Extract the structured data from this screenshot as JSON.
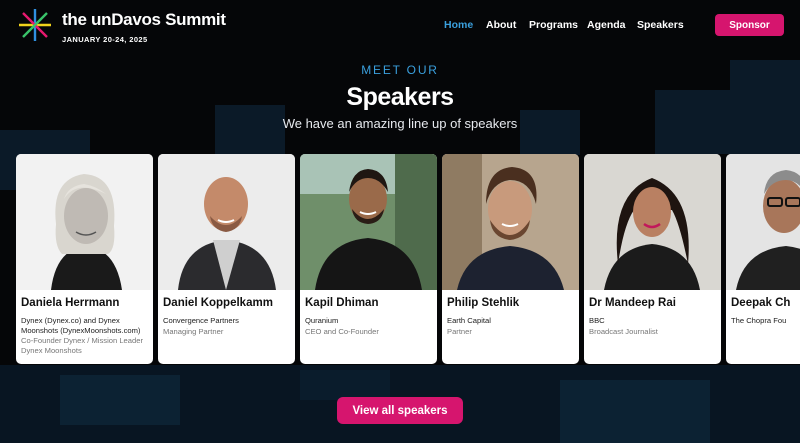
{
  "brand": {
    "title": "the unDavos Summit",
    "date": "JANUARY 20-24, 2025"
  },
  "nav": {
    "items": [
      "Home",
      "About",
      "Programs",
      "Agenda",
      "Speakers"
    ],
    "active": "Home",
    "sponsor_label": "Sponsor"
  },
  "section": {
    "eyebrow": "MEET OUR",
    "title": "Speakers",
    "subtitle": "We have an amazing line up of speakers"
  },
  "speakers": [
    {
      "name": "Daniela Herrmann",
      "org": "Dynex (Dynex.co) and Dynex Moonshots (DynexMoonshots.com)",
      "role": "Co-Founder Dynex / Mission Leader Dynex Moonshots"
    },
    {
      "name": "Daniel Koppelkamm",
      "org": "Convergence Partners",
      "role": "Managing Partner"
    },
    {
      "name": "Kapil Dhiman",
      "org": "Quranium",
      "role": "CEO and Co-Founder"
    },
    {
      "name": "Philip Stehlik",
      "org": "Earth Capital",
      "role": "Partner"
    },
    {
      "name": "Dr Mandeep Rai",
      "org": "BBC",
      "role": "Broadcast Journalist"
    },
    {
      "name": "Deepak Ch",
      "org": "The Chopra Fou",
      "role": ""
    }
  ],
  "cta": {
    "view_all_label": "View all speakers"
  },
  "colors": {
    "accent": "#d6156e",
    "eyebrow": "#3aa0de",
    "nav_active": "#3aa0de",
    "background": "#050608"
  }
}
